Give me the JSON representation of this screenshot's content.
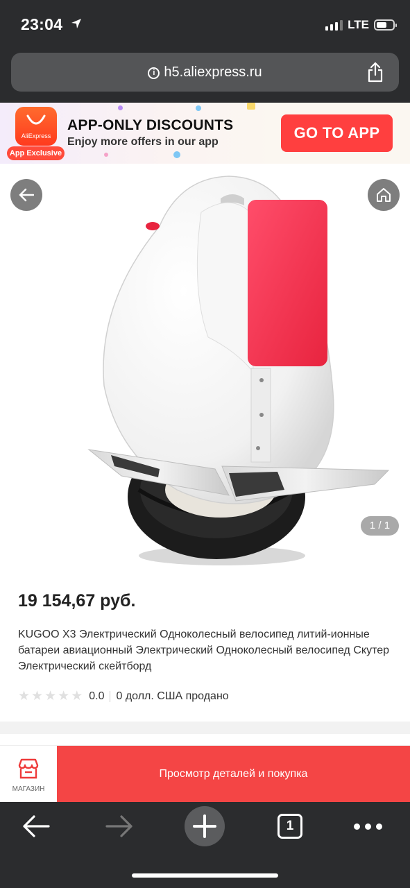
{
  "status_bar": {
    "time": "23:04",
    "network": "LTE",
    "battery_level": 0.62
  },
  "browser": {
    "url": "h5.aliexpress.ru",
    "info_glyph": "i",
    "share_icon": "share-icon"
  },
  "promo_banner": {
    "logo_text": "AliExpress",
    "badge": "App Exclusive",
    "title": "APP-ONLY DISCOUNTS",
    "subtitle": "Enjoy more offers in our app",
    "cta": "GO TO APP",
    "accent_color": "#ff3f3f"
  },
  "product": {
    "image_counter": "1 / 1",
    "price": "19 154,67 руб.",
    "title": "KUGOO X3 Электрический Одноколесный велосипед литий-ионные батареи авиационный Электрический Одноколесный велосипед Скутер Электрический скейтборд",
    "rating_stars": 0,
    "rating_value": "0.0",
    "sold_text": "0 долл. США продано"
  },
  "action_bar": {
    "store_label": "МАГАЗИН",
    "buy_label": "Просмотр деталей и покупка",
    "buy_color": "#f44545"
  },
  "toolbar": {
    "open_tabs": "1",
    "items": [
      "back-arrow-icon",
      "forward-arrow-icon",
      "new-tab-plus-icon",
      "tabs-icon",
      "more-icon"
    ]
  }
}
